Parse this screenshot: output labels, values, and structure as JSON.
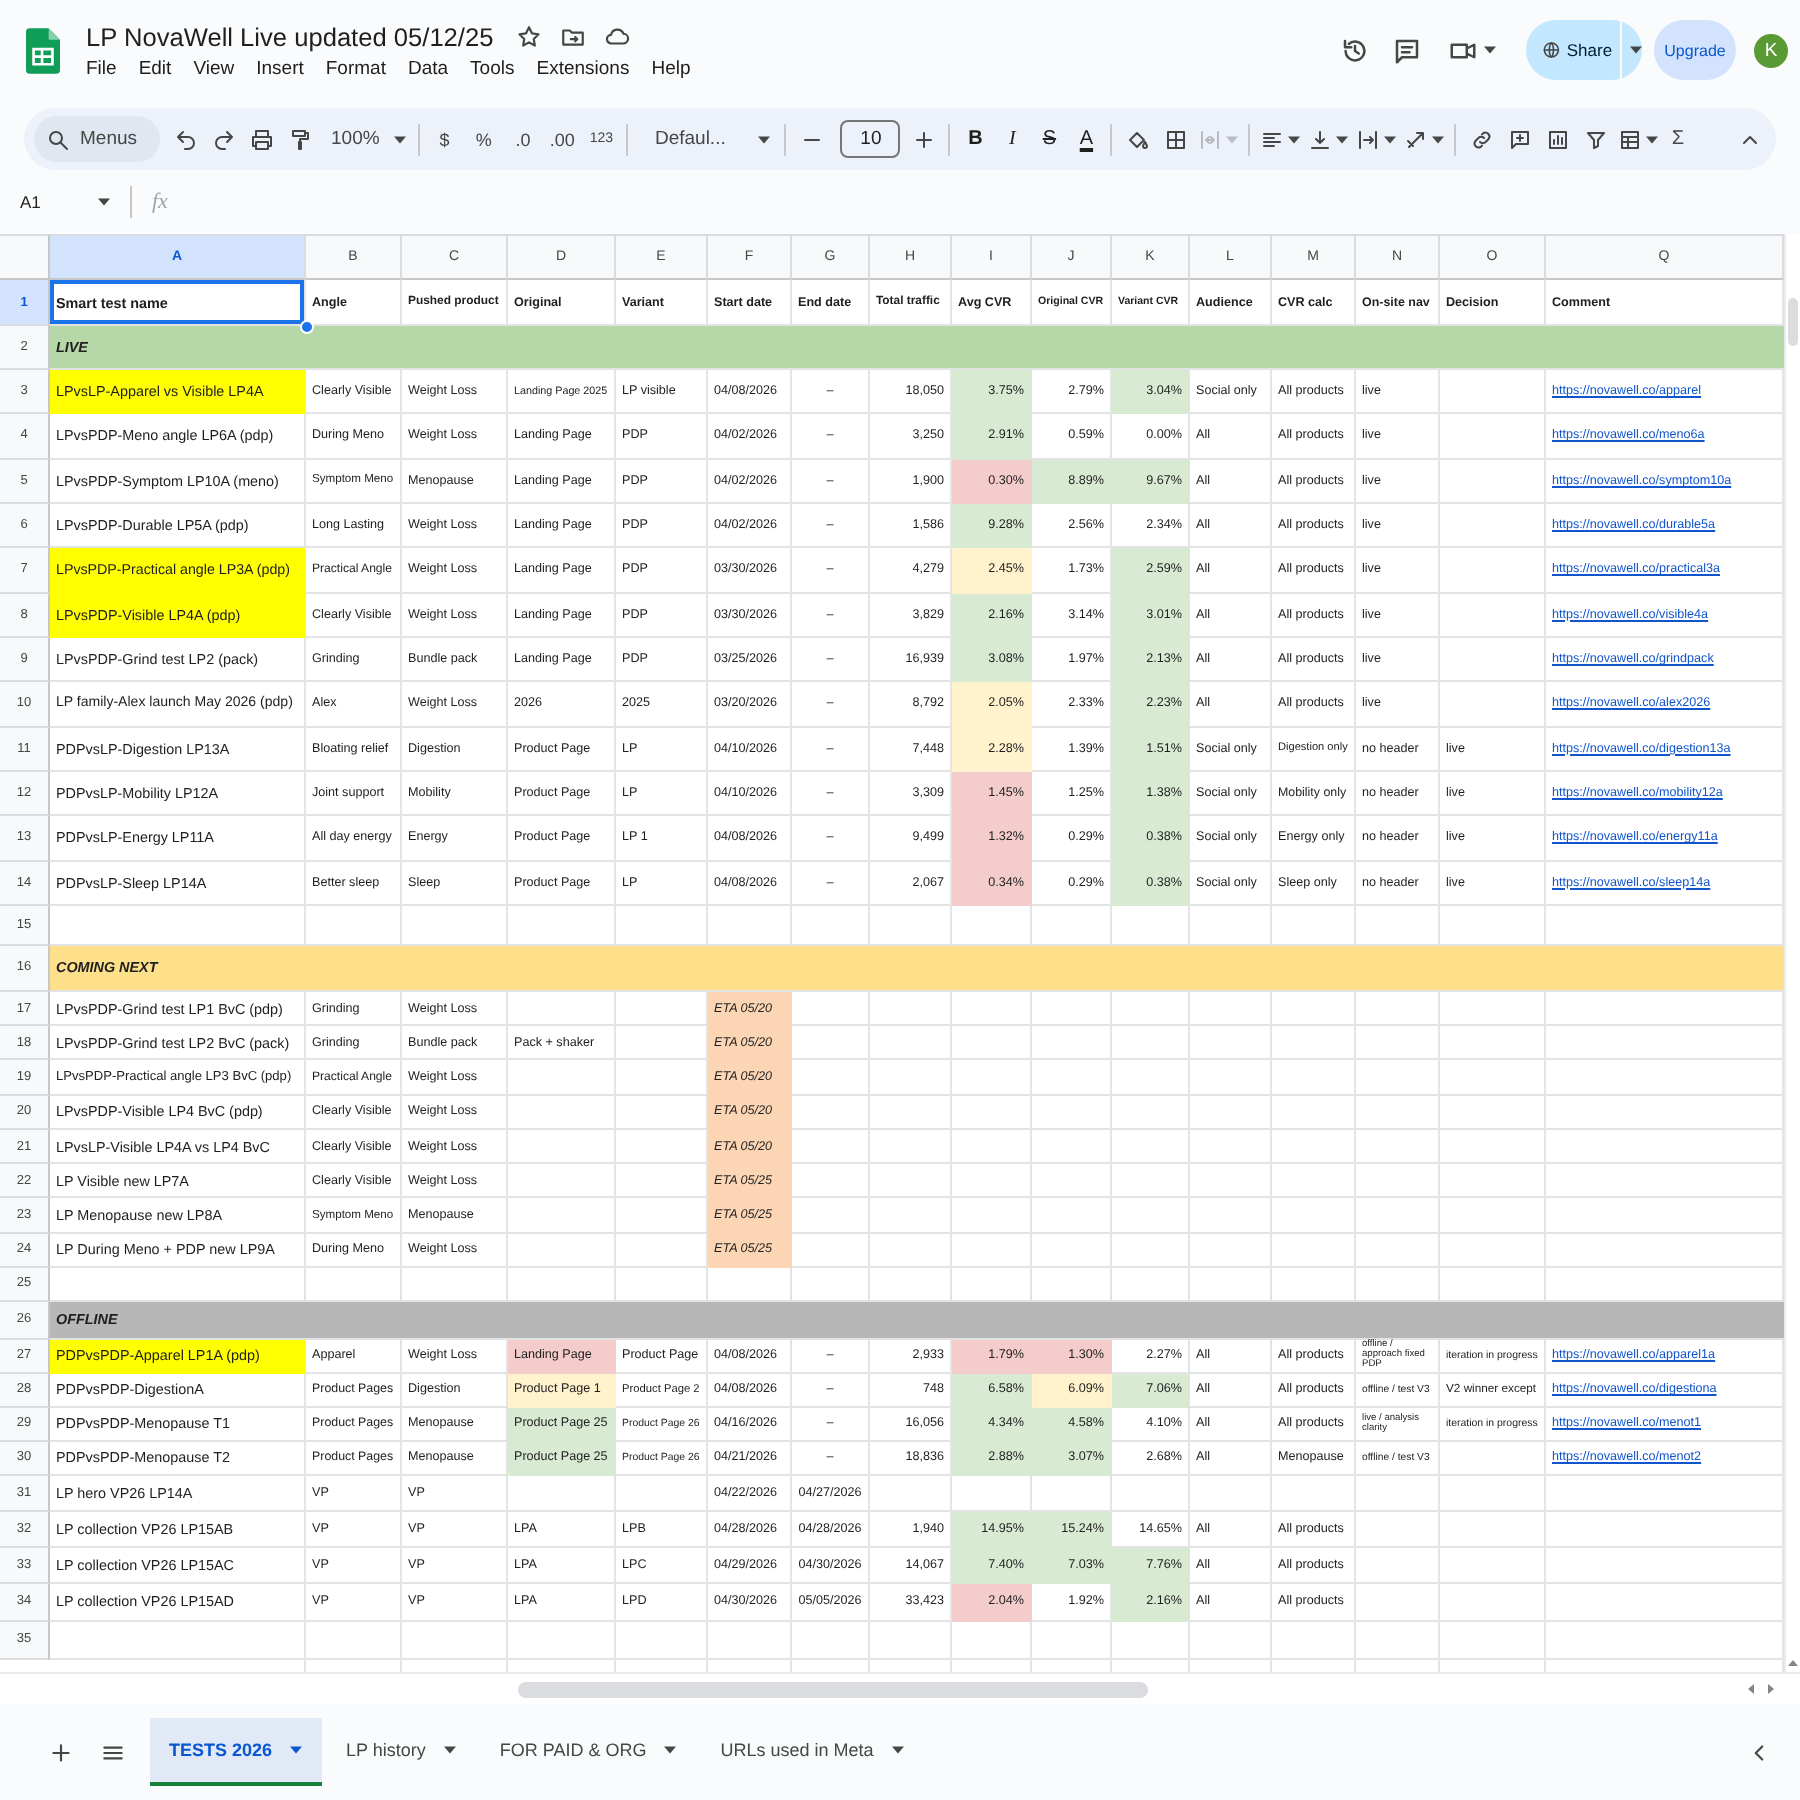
{
  "window": {
    "title": "LP NovaWell Live updated 05/12/25"
  },
  "menu": [
    "File",
    "Edit",
    "View",
    "Insert",
    "Format",
    "Data",
    "Tools",
    "Extensions",
    "Help"
  ],
  "header_actions": {
    "share": "Share",
    "upgrade": "Upgrade",
    "account_initial": "K"
  },
  "toolbar": {
    "menu_search": "Menus",
    "zoom": "100%",
    "currency": "$",
    "percent": "%",
    "decrease_decimals": ".0",
    "increase_decimals": ".00",
    "number_formats": "123",
    "font": "Defaul...",
    "font_size": "10",
    "bold": "B",
    "italic": "I",
    "strikethrough": "S",
    "text_color": "A",
    "merge_cells": {
      "disabled": true
    },
    "functions": "Σ"
  },
  "formula_bar": {
    "cell_ref": "A1",
    "function_label": "fx"
  },
  "sheet": {
    "columns": [
      {
        "letter": "A",
        "selected": true
      },
      {
        "letter": "B",
        "selected": false
      },
      {
        "letter": "C",
        "selected": false
      },
      {
        "letter": "D",
        "selected": false
      },
      {
        "letter": "E",
        "selected": false
      },
      {
        "letter": "F",
        "selected": false
      },
      {
        "letter": "G",
        "selected": false
      },
      {
        "letter": "H",
        "selected": false
      },
      {
        "letter": "I",
        "selected": false
      },
      {
        "letter": "J",
        "selected": false
      },
      {
        "letter": "K",
        "selected": false
      },
      {
        "letter": "L",
        "selected": false
      },
      {
        "letter": "M",
        "selected": false
      },
      {
        "letter": "N",
        "selected": false
      },
      {
        "letter": "O",
        "selected": false
      },
      {
        "letter": "Q",
        "selected": false
      }
    ],
    "rows": [
      {
        "num": "1",
        "kind": "header",
        "selected": true,
        "name": "Smart test name",
        "angle": "Angle",
        "pushed_product": "Pushed product",
        "original": "Original",
        "variant": "Variant",
        "start_date": "Start date",
        "end_date": "End date",
        "total_traffic": "Total traffic",
        "avg_cvr": "Avg CVR",
        "original_cvr": "Original CVR",
        "variant_cvr": "Variant CVR",
        "audience": "Audience",
        "cvr_calc": "CVR calc",
        "on_site_nav": "On-site nav",
        "decision": "Decision",
        "comment": "Comment"
      },
      {
        "num": "2",
        "kind": "section",
        "selected": false,
        "label": "LIVE",
        "color": "#b6d7a8"
      },
      {
        "num": "3",
        "kind": "test",
        "selected": false,
        "name": {
          "text": "LPvsLP-Apparel vs Visible LP4A",
          "color": "#ffff00"
        },
        "angle": "Clearly Visible",
        "pushed_product": "Weight Loss",
        "original": "Landing Page 2025",
        "variant": "LP visible",
        "start_date": "04/08/2026",
        "end_date": "–",
        "total_traffic": "18,050",
        "avg_cvr": {
          "text": "3.75%",
          "color": "#d9ead3"
        },
        "original_cvr": "2.79%",
        "variant_cvr": {
          "text": "3.04%",
          "color": "#d9ead3"
        },
        "audience": "Social only",
        "cvr_calc": "All products",
        "on_site_nav": "live",
        "comment": "https://novawell.co/apparel"
      },
      {
        "num": "4",
        "kind": "test",
        "selected": false,
        "name": "LPvsPDP-Meno angle LP6A (pdp)",
        "angle": "During Meno",
        "pushed_product": "Weight Loss",
        "original": "Landing Page",
        "variant": "PDP",
        "start_date": "04/02/2026",
        "end_date": "–",
        "total_traffic": "3,250",
        "avg_cvr": {
          "text": "2.91%",
          "color": "#d9ead3"
        },
        "original_cvr": "0.59%",
        "variant_cvr": "0.00%",
        "audience": "All",
        "cvr_calc": "All products",
        "on_site_nav": "live",
        "comment": "https://novawell.co/meno6a"
      },
      {
        "num": "5",
        "kind": "test",
        "selected": false,
        "name": "LPvsPDP-Symptom LP10A (meno)",
        "angle": "Symptom Meno",
        "pushed_product": "Menopause",
        "original": "Landing Page",
        "variant": "PDP",
        "start_date": "04/02/2026",
        "end_date": "–",
        "total_traffic": "1,900",
        "avg_cvr": {
          "text": "0.30%",
          "color": "#f4cccc"
        },
        "original_cvr": {
          "text": "8.89%",
          "color": "#d9ead3"
        },
        "variant_cvr": {
          "text": "9.67%",
          "color": "#d9ead3"
        },
        "audience": "All",
        "cvr_calc": "All products",
        "on_site_nav": "live",
        "comment": "https://novawell.co/symptom10a"
      },
      {
        "num": "6",
        "kind": "test",
        "selected": false,
        "name": "LPvsPDP-Durable LP5A (pdp)",
        "angle": "Long Lasting",
        "pushed_product": "Weight Loss",
        "original": "Landing Page",
        "variant": "PDP",
        "start_date": "04/02/2026",
        "end_date": "–",
        "total_traffic": "1,586",
        "avg_cvr": {
          "text": "9.28%",
          "color": "#d9ead3"
        },
        "original_cvr": "2.56%",
        "variant_cvr": "2.34%",
        "audience": "All",
        "cvr_calc": "All products",
        "on_site_nav": "live",
        "comment": "https://novawell.co/durable5a"
      },
      {
        "num": "7",
        "kind": "test",
        "selected": false,
        "name": {
          "text": "LPvsPDP-Practical angle LP3A (pdp)",
          "color": "#ffff00"
        },
        "angle": "Practical Angle",
        "pushed_product": "Weight Loss",
        "original": "Landing Page",
        "variant": "PDP",
        "start_date": "03/30/2026",
        "end_date": "–",
        "total_traffic": "4,279",
        "avg_cvr": {
          "text": "2.45%",
          "color": "#fff2cc"
        },
        "original_cvr": "1.73%",
        "variant_cvr": {
          "text": "2.59%",
          "color": "#d9ead3"
        },
        "audience": "All",
        "cvr_calc": "All products",
        "on_site_nav": "live",
        "comment": "https://novawell.co/practical3a"
      },
      {
        "num": "8",
        "kind": "test",
        "selected": false,
        "name": {
          "text": "LPvsPDP-Visible LP4A (pdp)",
          "color": "#ffff00"
        },
        "angle": "Clearly Visible",
        "pushed_product": "Weight Loss",
        "original": "Landing Page",
        "variant": "PDP",
        "start_date": "03/30/2026",
        "end_date": "–",
        "total_traffic": "3,829",
        "avg_cvr": {
          "text": "2.16%",
          "color": "#d9ead3"
        },
        "original_cvr": "3.14%",
        "variant_cvr": {
          "text": "3.01%",
          "color": "#d9ead3"
        },
        "audience": "All",
        "cvr_calc": "All products",
        "on_site_nav": "live",
        "comment": "https://novawell.co/visible4a"
      },
      {
        "num": "9",
        "kind": "test",
        "selected": false,
        "name": "LPvsPDP-Grind test LP2 (pack)",
        "angle": "Grinding",
        "pushed_product": "Bundle pack",
        "original": "Landing Page",
        "variant": "PDP",
        "start_date": "03/25/2026",
        "end_date": "–",
        "total_traffic": "16,939",
        "avg_cvr": {
          "text": "3.08%",
          "color": "#d9ead3"
        },
        "original_cvr": "1.97%",
        "variant_cvr": {
          "text": "2.13%",
          "color": "#d9ead3"
        },
        "audience": "All",
        "cvr_calc": "All products",
        "on_site_nav": "live",
        "comment": "https://novawell.co/grindpack"
      },
      {
        "num": "10",
        "kind": "test",
        "selected": false,
        "name": "LP family-Alex launch May 2026 (pdp)",
        "angle": "Alex",
        "pushed_product": "Weight Loss",
        "original": "2026",
        "variant": "2025",
        "start_date": "03/20/2026",
        "end_date": "–",
        "total_traffic": "8,792",
        "avg_cvr": {
          "text": "2.05%",
          "color": "#fff2cc"
        },
        "original_cvr": "2.33%",
        "variant_cvr": {
          "text": "2.23%",
          "color": "#d9ead3"
        },
        "audience": "All",
        "cvr_calc": "All products",
        "on_site_nav": "live",
        "comment": "https://novawell.co/alex2026"
      },
      {
        "num": "11",
        "kind": "test",
        "selected": false,
        "name": "PDPvsLP-Digestion LP13A",
        "angle": "Bloating relief",
        "pushed_product": "Digestion",
        "original": "Product Page",
        "variant": "LP",
        "start_date": "04/10/2026",
        "end_date": "–",
        "total_traffic": "7,448",
        "avg_cvr": {
          "text": "2.28%",
          "color": "#fff2cc"
        },
        "original_cvr": "1.39%",
        "variant_cvr": {
          "text": "1.51%",
          "color": "#d9ead3"
        },
        "audience": "Social only",
        "cvr_calc": "Digestion only",
        "on_site_nav": "no header",
        "decision": "live",
        "comment": "https://novawell.co/digestion13a"
      },
      {
        "num": "12",
        "kind": "test",
        "selected": false,
        "name": "PDPvsLP-Mobility LP12A",
        "angle": "Joint support",
        "pushed_product": "Mobility",
        "original": "Product Page",
        "variant": "LP",
        "start_date": "04/10/2026",
        "end_date": "–",
        "total_traffic": "3,309",
        "avg_cvr": {
          "text": "1.45%",
          "color": "#f4cccc"
        },
        "original_cvr": "1.25%",
        "variant_cvr": {
          "text": "1.38%",
          "color": "#d9ead3"
        },
        "audience": "Social only",
        "cvr_calc": "Mobility only",
        "on_site_nav": "no header",
        "decision": "live",
        "comment": "https://novawell.co/mobility12a"
      },
      {
        "num": "13",
        "kind": "test",
        "selected": false,
        "name": "PDPvsLP-Energy LP11A",
        "angle": "All day energy",
        "pushed_product": "Energy",
        "original": "Product Page",
        "variant": "LP 1",
        "start_date": "04/08/2026",
        "end_date": "–",
        "total_traffic": "9,499",
        "avg_cvr": {
          "text": "1.32%",
          "color": "#f4cccc"
        },
        "original_cvr": "0.29%",
        "variant_cvr": {
          "text": "0.38%",
          "color": "#d9ead3"
        },
        "audience": "Social only",
        "cvr_calc": "Energy only",
        "on_site_nav": "no header",
        "decision": "live",
        "comment": "https://novawell.co/energy11a"
      },
      {
        "num": "14",
        "kind": "test",
        "selected": false,
        "name": "PDPvsLP-Sleep LP14A",
        "angle": "Better sleep",
        "pushed_product": "Sleep",
        "original": "Product Page",
        "variant": "LP",
        "start_date": "04/08/2026",
        "end_date": "–",
        "total_traffic": "2,067",
        "avg_cvr": {
          "text": "0.34%",
          "color": "#f4cccc"
        },
        "original_cvr": "0.29%",
        "variant_cvr": {
          "text": "0.38%",
          "color": "#d9ead3"
        },
        "audience": "Social only",
        "cvr_calc": "Sleep only",
        "on_site_nav": "no header",
        "decision": "live",
        "comment": "https://novawell.co/sleep14a"
      },
      {
        "num": "15",
        "kind": "blank",
        "selected": false
      },
      {
        "num": "16",
        "kind": "section",
        "selected": false,
        "label": "COMING NEXT",
        "color": "#ffe08a"
      },
      {
        "num": "17",
        "kind": "planned",
        "selected": false,
        "name": "LPvsPDP-Grind test LP1 BvC (pdp)",
        "angle": "Grinding",
        "pushed_product": "Weight Loss",
        "start_date": {
          "text": "ETA 05/20",
          "color": "#fcd5b4"
        }
      },
      {
        "num": "18",
        "kind": "planned",
        "selected": false,
        "name": "LPvsPDP-Grind test LP2 BvC (pack)",
        "angle": "Grinding",
        "pushed_product": "Bundle pack",
        "original": "Pack + shaker",
        "start_date": {
          "text": "ETA 05/20",
          "color": "#fcd5b4"
        }
      },
      {
        "num": "19",
        "kind": "planned",
        "selected": false,
        "name": "LPvsPDP-Practical angle LP3 BvC (pdp)",
        "angle": "Practical Angle",
        "pushed_product": "Weight Loss",
        "start_date": {
          "text": "ETA 05/20",
          "color": "#fcd5b4"
        }
      },
      {
        "num": "20",
        "kind": "planned",
        "selected": false,
        "name": "LPvsPDP-Visible LP4 BvC (pdp)",
        "angle": "Clearly Visible",
        "pushed_product": "Weight Loss",
        "start_date": {
          "text": "ETA 05/20",
          "color": "#fcd5b4"
        }
      },
      {
        "num": "21",
        "kind": "planned",
        "selected": false,
        "name": "LPvsLP-Visible LP4A vs LP4 BvC",
        "angle": "Clearly Visible",
        "pushed_product": "Weight Loss",
        "start_date": {
          "text": "ETA 05/20",
          "color": "#fcd5b4"
        }
      },
      {
        "num": "22",
        "kind": "planned",
        "selected": false,
        "name": "LP Visible new LP7A",
        "angle": "Clearly Visible",
        "pushed_product": "Weight Loss",
        "start_date": {
          "text": "ETA 05/25",
          "color": "#fcd5b4"
        }
      },
      {
        "num": "23",
        "kind": "planned",
        "selected": false,
        "name": "LP Menopause new LP8A",
        "angle": "Symptom Meno",
        "pushed_product": "Menopause",
        "start_date": {
          "text": "ETA 05/25",
          "color": "#fcd5b4"
        }
      },
      {
        "num": "24",
        "kind": "planned",
        "selected": false,
        "name": "LP During Meno + PDP new LP9A",
        "angle": "During Meno",
        "pushed_product": "Weight Loss",
        "start_date": {
          "text": "ETA 05/25",
          "color": "#fcd5b4"
        }
      },
      {
        "num": "25",
        "kind": "blank",
        "selected": false
      },
      {
        "num": "26",
        "kind": "section",
        "selected": false,
        "label": "OFFLINE",
        "color": "#b7b7b7"
      },
      {
        "num": "27",
        "kind": "test",
        "selected": false,
        "name": {
          "text": "PDPvsPDP-Apparel LP1A (pdp)",
          "color": "#ffff00"
        },
        "angle": "Apparel",
        "pushed_product": "Weight Loss",
        "original": {
          "text": "Landing Page",
          "color": "#f4cccc"
        },
        "variant": "Product Page",
        "start_date": "04/08/2026",
        "end_date": "–",
        "total_traffic": "2,933",
        "avg_cvr": {
          "text": "1.79%",
          "color": "#f4cccc"
        },
        "original_cvr": {
          "text": "1.30%",
          "color": "#f4cccc"
        },
        "variant_cvr": "2.27%",
        "audience": "All",
        "cvr_calc": "All products",
        "on_site_nav": "offline / approach fixed PDP",
        "decision": "iteration in progress",
        "comment": "https://novawell.co/apparel1a"
      },
      {
        "num": "28",
        "kind": "test",
        "selected": false,
        "name": "PDPvsPDP-DigestionA",
        "angle": "Product Pages",
        "pushed_product": "Digestion",
        "original": {
          "text": "Product Page 1",
          "color": "#fff2cc"
        },
        "variant": "Product Page 2",
        "start_date": "04/08/2026",
        "end_date": "–",
        "total_traffic": "748",
        "avg_cvr": {
          "text": "6.58%",
          "color": "#d9ead3"
        },
        "original_cvr": {
          "text": "6.09%",
          "color": "#fff2cc"
        },
        "variant_cvr": {
          "text": "7.06%",
          "color": "#d9ead3"
        },
        "audience": "All",
        "cvr_calc": "All products",
        "on_site_nav": "offline / test V3",
        "decision": "V2 winner except",
        "comment": "https://novawell.co/digestiona"
      },
      {
        "num": "29",
        "kind": "test",
        "selected": false,
        "name": "PDPvsPDP-Menopause T1",
        "angle": "Product Pages",
        "pushed_product": "Menopause",
        "original": {
          "text": "Product Page 25",
          "color": "#d9ead3"
        },
        "variant": "Product Page 26",
        "start_date": "04/16/2026",
        "end_date": "–",
        "total_traffic": "16,056",
        "avg_cvr": {
          "text": "4.34%",
          "color": "#d9ead3"
        },
        "original_cvr": {
          "text": "4.58%",
          "color": "#d9ead3"
        },
        "variant_cvr": "4.10%",
        "audience": "All",
        "cvr_calc": "All products",
        "on_site_nav": "live / analysis clarity",
        "decision": "iteration in progress",
        "comment": "https://novawell.co/menot1"
      },
      {
        "num": "30",
        "kind": "test",
        "selected": false,
        "name": "PDPvsPDP-Menopause T2",
        "angle": "Product Pages",
        "pushed_product": "Menopause",
        "original": {
          "text": "Product Page 25",
          "color": "#d9ead3"
        },
        "variant": "Product Page 26",
        "start_date": "04/21/2026",
        "end_date": "–",
        "total_traffic": "18,836",
        "avg_cvr": {
          "text": "2.88%",
          "color": "#d9ead3"
        },
        "original_cvr": {
          "text": "3.07%",
          "color": "#d9ead3"
        },
        "variant_cvr": "2.68%",
        "audience": "All",
        "cvr_calc": "Menopause",
        "on_site_nav": "offline / test V3",
        "comment": "https://novawell.co/menot2"
      },
      {
        "num": "31",
        "kind": "test",
        "selected": false,
        "name": "LP hero VP26 LP14A",
        "angle": "VP",
        "pushed_product": "VP",
        "start_date": "04/22/2026",
        "end_date": "04/27/2026"
      },
      {
        "num": "32",
        "kind": "test",
        "selected": false,
        "name": "LP collection VP26 LP15AB",
        "angle": "VP",
        "pushed_product": "VP",
        "original": "LPA",
        "variant": "LPB",
        "start_date": "04/28/2026",
        "end_date": "04/28/2026",
        "total_traffic": "1,940",
        "avg_cvr": {
          "text": "14.95%",
          "color": "#d9ead3"
        },
        "original_cvr": {
          "text": "15.24%",
          "color": "#d9ead3"
        },
        "variant_cvr": "14.65%",
        "audience": "All",
        "cvr_calc": "All products"
      },
      {
        "num": "33",
        "kind": "test",
        "selected": false,
        "name": "LP collection VP26 LP15AC",
        "angle": "VP",
        "pushed_product": "VP",
        "original": "LPA",
        "variant": "LPC",
        "start_date": "04/29/2026",
        "end_date": "04/30/2026",
        "total_traffic": "14,067",
        "avg_cvr": {
          "text": "7.40%",
          "color": "#d9ead3"
        },
        "original_cvr": {
          "text": "7.03%",
          "color": "#d9ead3"
        },
        "variant_cvr": {
          "text": "7.76%",
          "color": "#d9ead3"
        },
        "audience": "All",
        "cvr_calc": "All products"
      },
      {
        "num": "34",
        "kind": "test",
        "selected": false,
        "name": "LP collection VP26 LP15AD",
        "angle": "VP",
        "pushed_product": "VP",
        "original": "LPA",
        "variant": "LPD",
        "start_date": "04/30/2026",
        "end_date": "05/05/2026",
        "total_traffic": "33,423",
        "avg_cvr": {
          "text": "2.04%",
          "color": "#f4cccc"
        },
        "original_cvr": "1.92%",
        "variant_cvr": {
          "text": "2.16%",
          "color": "#d9ead3"
        },
        "audience": "All",
        "cvr_calc": "All products"
      },
      {
        "num": "35",
        "kind": "blank",
        "selected": false
      }
    ]
  },
  "sheet_tabs": [
    {
      "label": "TESTS 2026",
      "selected": true
    },
    {
      "label": "LP history",
      "selected": false
    },
    {
      "label": "FOR PAID & ORG",
      "selected": false
    },
    {
      "label": "URLs used in Meta",
      "selected": false
    }
  ]
}
